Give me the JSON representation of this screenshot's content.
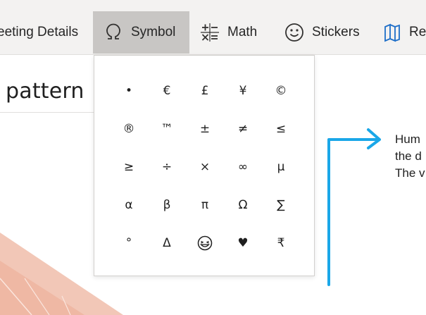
{
  "ribbon": {
    "tabs": [
      {
        "label": "eeting Details",
        "icon": "none"
      },
      {
        "label": "Symbol",
        "icon": "omega-icon"
      },
      {
        "label": "Math",
        "icon": "math-operators-icon"
      },
      {
        "label": "Stickers",
        "icon": "smiley-icon"
      },
      {
        "label": "Re",
        "icon": "book-icon"
      }
    ],
    "selected": "Symbol",
    "accent": "#c8c6c4"
  },
  "document": {
    "heading": "pattern",
    "side_text": [
      "Hum",
      "the d",
      "The v"
    ],
    "arrow_color": "#1aa7e8"
  },
  "symbols": [
    "•",
    "€",
    "£",
    "¥",
    "©",
    "®",
    "™",
    "±",
    "≠",
    "≤",
    "≥",
    "÷",
    "×",
    "∞",
    "µ",
    "α",
    "β",
    "π",
    "Ω",
    "∑",
    "°",
    "Δ",
    "",
    "♥",
    "₹"
  ]
}
